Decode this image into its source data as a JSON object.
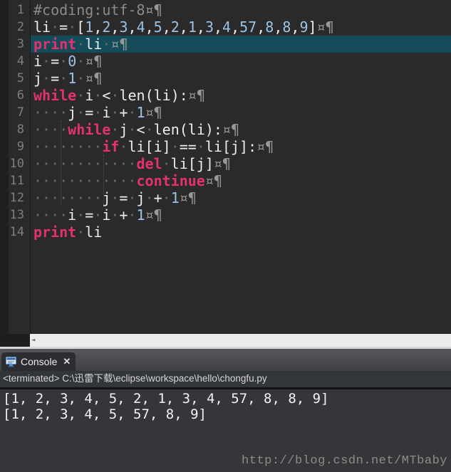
{
  "editor": {
    "highlighted_line": "3",
    "lines": [
      {
        "n": "1",
        "hl": false,
        "seg": [
          [
            "c",
            "#coding:utf-8"
          ],
          [
            "e",
            "¤¶"
          ]
        ]
      },
      {
        "n": "2",
        "hl": false,
        "seg": [
          [
            "d",
            "li"
          ],
          [
            "w",
            "·"
          ],
          [
            "d",
            "="
          ],
          [
            "w",
            "·"
          ],
          [
            "d",
            "["
          ],
          [
            "n",
            "1"
          ],
          [
            "d",
            ","
          ],
          [
            "n",
            "2"
          ],
          [
            "d",
            ","
          ],
          [
            "n",
            "3"
          ],
          [
            "d",
            ","
          ],
          [
            "n",
            "4"
          ],
          [
            "d",
            ","
          ],
          [
            "n",
            "5"
          ],
          [
            "d",
            ","
          ],
          [
            "n",
            "2"
          ],
          [
            "d",
            ","
          ],
          [
            "n",
            "1"
          ],
          [
            "d",
            ","
          ],
          [
            "n",
            "3"
          ],
          [
            "d",
            ","
          ],
          [
            "n",
            "4"
          ],
          [
            "d",
            ","
          ],
          [
            "n",
            "57"
          ],
          [
            "d",
            ","
          ],
          [
            "n",
            "8"
          ],
          [
            "d",
            ","
          ],
          [
            "n",
            "8"
          ],
          [
            "d",
            ","
          ],
          [
            "n",
            "9"
          ],
          [
            "d",
            "]"
          ],
          [
            "e",
            "¤¶"
          ]
        ]
      },
      {
        "n": "3",
        "hl": true,
        "seg": [
          [
            "k",
            "print"
          ],
          [
            "w",
            "·"
          ],
          [
            "d",
            "li"
          ],
          [
            "w",
            "·"
          ],
          [
            "e",
            "¤¶"
          ]
        ]
      },
      {
        "n": "4",
        "hl": false,
        "seg": [
          [
            "d",
            "i"
          ],
          [
            "w",
            "·"
          ],
          [
            "d",
            "="
          ],
          [
            "w",
            "·"
          ],
          [
            "n",
            "0"
          ],
          [
            "w",
            "·"
          ],
          [
            "e",
            "¤¶"
          ]
        ]
      },
      {
        "n": "5",
        "hl": false,
        "seg": [
          [
            "d",
            "j"
          ],
          [
            "w",
            "·"
          ],
          [
            "d",
            "="
          ],
          [
            "w",
            "·"
          ],
          [
            "n",
            "1"
          ],
          [
            "w",
            "·"
          ],
          [
            "e",
            "¤¶"
          ]
        ]
      },
      {
        "n": "6",
        "hl": false,
        "seg": [
          [
            "k",
            "while"
          ],
          [
            "w",
            "·"
          ],
          [
            "d",
            "i"
          ],
          [
            "w",
            "·"
          ],
          [
            "d",
            "<"
          ],
          [
            "w",
            "·"
          ],
          [
            "d",
            "len(li):"
          ],
          [
            "e",
            "¤¶"
          ]
        ]
      },
      {
        "n": "7",
        "hl": false,
        "seg": [
          [
            "w",
            "····"
          ],
          [
            "d",
            "j"
          ],
          [
            "w",
            "·"
          ],
          [
            "d",
            "="
          ],
          [
            "w",
            "·"
          ],
          [
            "d",
            "i"
          ],
          [
            "w",
            "·"
          ],
          [
            "d",
            "+"
          ],
          [
            "w",
            "·"
          ],
          [
            "n",
            "1"
          ],
          [
            "e",
            "¤¶"
          ]
        ]
      },
      {
        "n": "8",
        "hl": false,
        "seg": [
          [
            "w",
            "····"
          ],
          [
            "k",
            "while"
          ],
          [
            "w",
            "·"
          ],
          [
            "d",
            "j"
          ],
          [
            "w",
            "·"
          ],
          [
            "d",
            "<"
          ],
          [
            "w",
            "·"
          ],
          [
            "d",
            "len(li):"
          ],
          [
            "e",
            "¤¶"
          ]
        ]
      },
      {
        "n": "9",
        "hl": false,
        "seg": [
          [
            "w",
            "········"
          ],
          [
            "k",
            "if"
          ],
          [
            "w",
            "·"
          ],
          [
            "d",
            "li[i]"
          ],
          [
            "w",
            "·"
          ],
          [
            "d",
            "=="
          ],
          [
            "w",
            "·"
          ],
          [
            "d",
            "li[j]:"
          ],
          [
            "e",
            "¤¶"
          ]
        ]
      },
      {
        "n": "10",
        "hl": false,
        "seg": [
          [
            "w",
            "············"
          ],
          [
            "k",
            "del"
          ],
          [
            "w",
            "·"
          ],
          [
            "d",
            "li[j]"
          ],
          [
            "e",
            "¤¶"
          ]
        ]
      },
      {
        "n": "11",
        "hl": false,
        "seg": [
          [
            "w",
            "············"
          ],
          [
            "k",
            "continue"
          ],
          [
            "e",
            "¤¶"
          ]
        ]
      },
      {
        "n": "12",
        "hl": false,
        "seg": [
          [
            "w",
            "········"
          ],
          [
            "d",
            "j"
          ],
          [
            "w",
            "·"
          ],
          [
            "d",
            "="
          ],
          [
            "w",
            "·"
          ],
          [
            "d",
            "j"
          ],
          [
            "w",
            "·"
          ],
          [
            "d",
            "+"
          ],
          [
            "w",
            "·"
          ],
          [
            "n",
            "1"
          ],
          [
            "e",
            "¤¶"
          ]
        ]
      },
      {
        "n": "13",
        "hl": false,
        "seg": [
          [
            "w",
            "····"
          ],
          [
            "d",
            "i"
          ],
          [
            "w",
            "·"
          ],
          [
            "d",
            "="
          ],
          [
            "w",
            "·"
          ],
          [
            "d",
            "i"
          ],
          [
            "w",
            "·"
          ],
          [
            "d",
            "+"
          ],
          [
            "w",
            "·"
          ],
          [
            "n",
            "1"
          ],
          [
            "e",
            "¤¶"
          ]
        ]
      },
      {
        "n": "14",
        "hl": false,
        "seg": [
          [
            "k",
            "print"
          ],
          [
            "w",
            "·"
          ],
          [
            "d",
            "li"
          ]
        ]
      }
    ]
  },
  "scrollbar": {
    "left_arrow": "◄"
  },
  "console": {
    "tab_label": "Console",
    "close_label": "✕",
    "status_line": "<terminated> C:\\迅雷下载\\eclipse\\workspace\\hello\\chongfu.py",
    "output_lines": [
      "[1, 2, 3, 4, 5, 2, 1, 3, 4, 57, 8, 8, 9]",
      "[1, 2, 3, 4, 5, 57, 8, 9]"
    ]
  },
  "watermark": "http://blog.csdn.net/MTbaby",
  "colors": {
    "editor_bg": "#2a2a2b",
    "current_line_highlight": "#144c5a",
    "keyword": "#e3326f",
    "number": "#9dc3e4",
    "default_text": "#ededed",
    "comment": "#8a8a8a",
    "line_number": "#7d7f81",
    "console_bg": "#343639",
    "console_icon_blue": "#5d8cc9"
  }
}
